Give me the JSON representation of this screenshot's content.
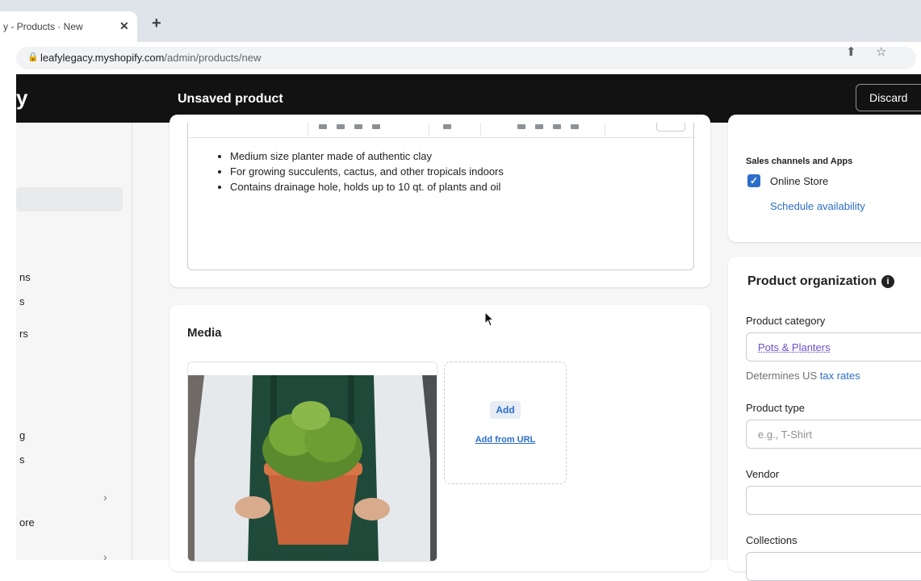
{
  "browser": {
    "tab_title": "y - Products · New",
    "tab_close": "✕",
    "new_tab": "+",
    "url_host": "leafylegacy.myshopify.com",
    "url_path": "/admin/products/new"
  },
  "topbar": {
    "logo_fragment": "y",
    "title": "Unsaved product",
    "discard_label": "Discard"
  },
  "sidebar": {
    "fragments": [
      "ns",
      "s",
      "rs",
      "g",
      "s",
      "ore"
    ]
  },
  "description": {
    "bullets": [
      "Medium size planter made of authentic clay",
      "For growing succulents, cactus, and other tropicals indoors",
      "Contains drainage hole, holds up to 10 qt. of plants and oil"
    ]
  },
  "media": {
    "title": "Media",
    "add_label": "Add",
    "add_url_label": "Add from URL"
  },
  "sales_channels": {
    "heading": "Sales channels and Apps",
    "online_store_label": "Online Store",
    "online_store_checked": true,
    "schedule_link": "Schedule availability"
  },
  "organization": {
    "title": "Product organization",
    "category_label": "Product category",
    "category_value": "Pots & Planters",
    "tax_note_prefix": "Determines US ",
    "tax_link": "tax rates",
    "type_label": "Product type",
    "type_placeholder": "e.g., T-Shirt",
    "vendor_label": "Vendor",
    "collections_label": "Collections"
  },
  "colors": {
    "topbar": "#121212",
    "accent": "#2c6ecb",
    "category_text": "#6e4fc9"
  }
}
